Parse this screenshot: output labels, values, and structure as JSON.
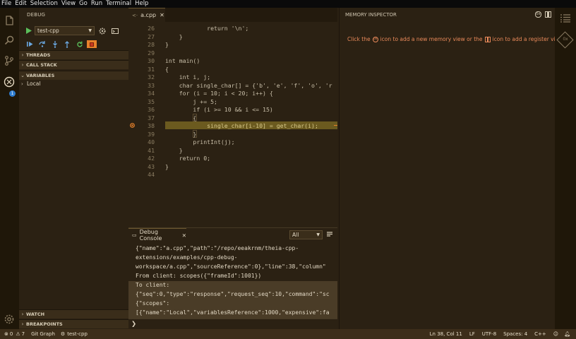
{
  "menu": [
    "File",
    "Edit",
    "Selection",
    "View",
    "Go",
    "Run",
    "Terminal",
    "Help"
  ],
  "activity": {
    "debug_badge": "1"
  },
  "sidebar": {
    "title": "DEBUG",
    "config_value": "test-cpp",
    "sections": {
      "threads": "THREADS",
      "call_stack": "CALL STACK",
      "variables": "VARIABLES",
      "watch": "WATCH",
      "breakpoints": "BREAKPOINTS"
    },
    "variables_local": "Local"
  },
  "editor": {
    "tab_label": "a.cpp",
    "lines": [
      {
        "n": "26",
        "t": "            return '\\n';"
      },
      {
        "n": "27",
        "t": "    }"
      },
      {
        "n": "28",
        "t": "}"
      },
      {
        "n": "29",
        "t": ""
      },
      {
        "n": "30",
        "t": "int main()"
      },
      {
        "n": "31",
        "t": "{"
      },
      {
        "n": "32",
        "t": "    int i, j;"
      },
      {
        "n": "33",
        "t": "    char single_char[] = {'b', 'e', 'f', 'o', 'r"
      },
      {
        "n": "34",
        "t": "    for (i = 10; i < 20; i++) {"
      },
      {
        "n": "35",
        "t": "        j += 5;"
      },
      {
        "n": "36",
        "t": "        if (i >= 10 && i <= 15)"
      },
      {
        "n": "37",
        "t": "        {"
      },
      {
        "n": "38",
        "t": "            single_char[i-10] = get_char(i);"
      },
      {
        "n": "39",
        "t": "        }"
      },
      {
        "n": "40",
        "t": "        printInt(j);"
      },
      {
        "n": "41",
        "t": "    }"
      },
      {
        "n": "42",
        "t": "    return 0;"
      },
      {
        "n": "43",
        "t": "}"
      },
      {
        "n": "44",
        "t": ""
      }
    ]
  },
  "panel": {
    "tab_label": "Debug Console",
    "filter_value": "All",
    "lines": [
      "{\"name\":\"a.cpp\",\"path\":\"/repo/eeakrnm/theia-cpp-",
      "extensions/examples/cpp-debug-",
      "workspace/a.cpp\",\"sourceReference\":0},\"line\":38,\"column\"",
      "From client: scopes({\"frameId\":1001})",
      "To client:",
      "{\"seq\":0,\"type\":\"response\",\"request_seq\":10,\"command\":\"sc",
      "{\"scopes\":",
      "[{\"name\":\"Local\",\"variablesReference\":1000,\"expensive\":fa"
    ],
    "prompt": "❯"
  },
  "memory_inspector": {
    "title": "MEMORY INSPECTOR",
    "hint_part1": "Click the",
    "hint_part2": "icon to add a new memory view or the",
    "hint_part3": "icon to add a register view."
  },
  "statusbar": {
    "errors": "0",
    "warnings": "7",
    "git": "Git Graph",
    "debug_config": "test-cpp",
    "position": "Ln 38, Col 11",
    "eol": "LF",
    "encoding": "UTF-8",
    "spaces": "Spaces: 4",
    "language": "C++"
  },
  "colors": {
    "accent": "#d9a441",
    "highlight_line": "#6b5a1f",
    "breakpoint": "#e8822b"
  }
}
